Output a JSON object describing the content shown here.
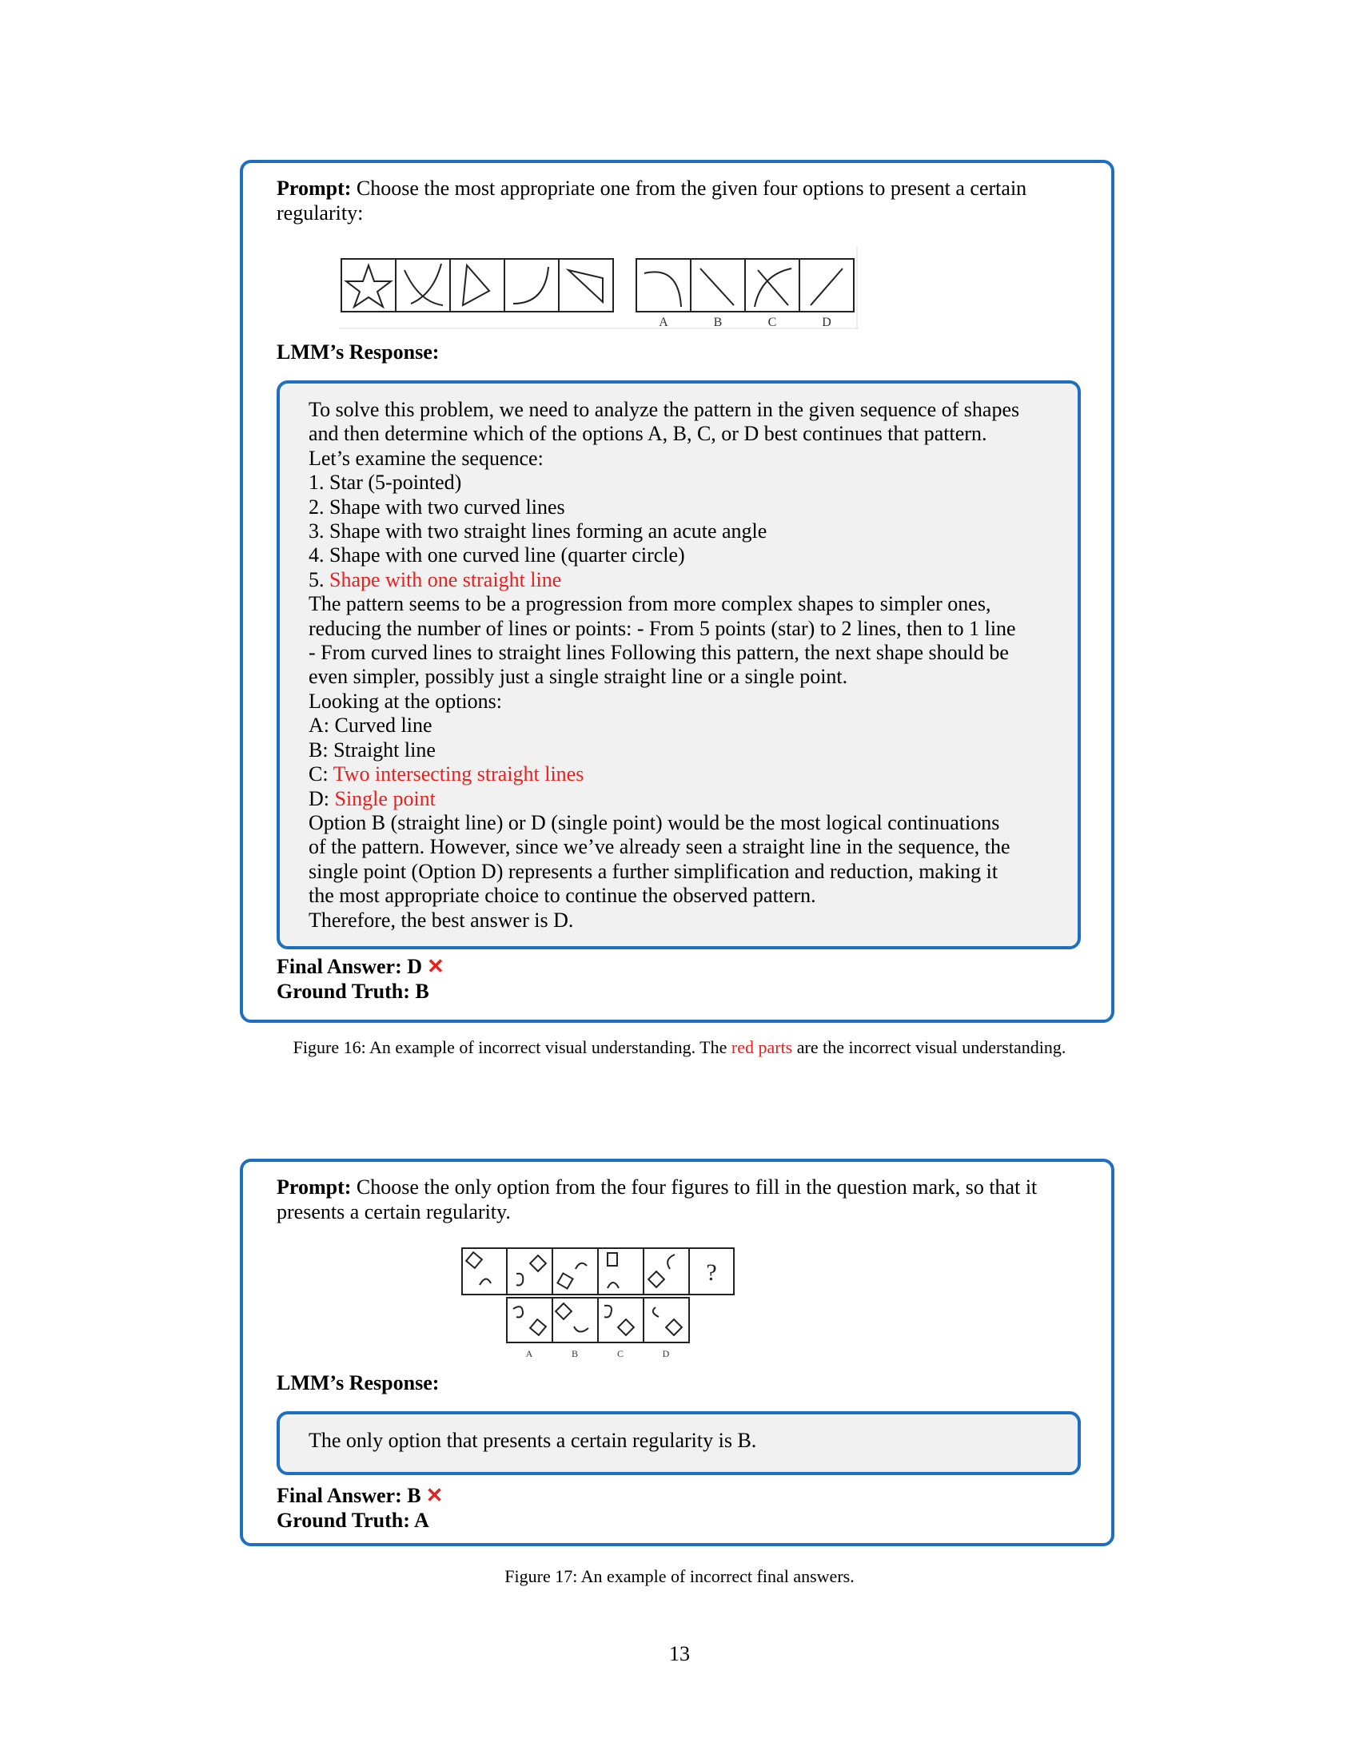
{
  "figure16": {
    "prompt_label": "Prompt:",
    "prompt_text": "Choose the most appropriate one from the given four options to present a certain regularity:",
    "option_labels": [
      "A",
      "B",
      "C",
      "D"
    ],
    "response_label": "LMM’s Response:",
    "response_lines": [
      [
        {
          "t": "To solve this problem, we need to analyze the pattern in the given sequence of shapes"
        }
      ],
      [
        {
          "t": "and then determine which of the options A, B, C, or D best continues that pattern."
        }
      ],
      [
        {
          "t": "Let’s examine the sequence:"
        }
      ],
      [
        {
          "t": "1. Star (5-pointed)"
        }
      ],
      [
        {
          "t": "2. Shape with two curved lines"
        }
      ],
      [
        {
          "t": "3. Shape with two straight lines forming an acute angle"
        }
      ],
      [
        {
          "t": "4. Shape with one curved line (quarter circle)"
        }
      ],
      [
        {
          "t": "5. "
        },
        {
          "t": "Shape with one straight line",
          "red": true
        }
      ],
      [
        {
          "t": "The pattern seems to be a progression from more complex shapes to simpler ones,"
        }
      ],
      [
        {
          "t": "reducing the number of lines or points: - From 5 points (star) to 2 lines, then to 1 line"
        }
      ],
      [
        {
          "t": "- From curved lines to straight lines Following this pattern, the next shape should be"
        }
      ],
      [
        {
          "t": "even simpler, possibly just a single straight line or a single point."
        }
      ],
      [
        {
          "t": "Looking at the options:"
        }
      ],
      [
        {
          "t": "A: Curved line"
        }
      ],
      [
        {
          "t": "B: Straight line"
        }
      ],
      [
        {
          "t": "C: "
        },
        {
          "t": "Two intersecting straight lines",
          "red": true
        }
      ],
      [
        {
          "t": "D: "
        },
        {
          "t": "Single point",
          "red": true
        }
      ],
      [
        {
          "t": "Option B (straight line) or D (single point) would be the most logical continuations"
        }
      ],
      [
        {
          "t": "of the pattern. However, since we’ve already seen a straight line in the sequence, the"
        }
      ],
      [
        {
          "t": "single point (Option D) represents a further simplification and reduction, making it"
        }
      ],
      [
        {
          "t": "the most appropriate choice to continue the observed pattern."
        }
      ],
      [
        {
          "t": "Therefore, the best answer is D."
        }
      ]
    ],
    "final_answer": "Final Answer: D",
    "ground_truth": "Ground Truth: B",
    "caption_prefix": "Figure 16:  An example of incorrect visual understanding. The ",
    "caption_red": "red parts",
    "caption_suffix": " are the incorrect visual understanding."
  },
  "figure17": {
    "prompt_label": "Prompt:",
    "prompt_text": "Choose the only option from the four figures to fill in the question mark, so that it presents a certain regularity.",
    "question_mark": "?",
    "option_labels": [
      "A",
      "B",
      "C",
      "D"
    ],
    "response_label": "LMM’s Response:",
    "response_text": "The only option that presents a certain regularity is B.",
    "final_answer": "Final Answer: B",
    "ground_truth": "Ground Truth: A",
    "caption": "Figure 17:  An example of incorrect final answers."
  },
  "x_mark": "✕",
  "page_number": "13"
}
